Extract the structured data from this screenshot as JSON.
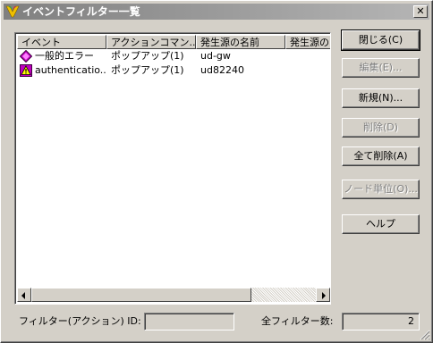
{
  "window": {
    "title": "イベントフィルター一覧",
    "close_glyph": "✕"
  },
  "list": {
    "columns": [
      "イベント",
      "アクションコマン...",
      "発生源の名前",
      "発生源の"
    ],
    "rows": [
      {
        "icon": "error-diamond-icon",
        "event": "一般的エラー",
        "action": "ポップアップ(1)",
        "source": "ud-gw"
      },
      {
        "icon": "warning-triangle-icon",
        "event": "authenticatio...",
        "action": "ポップアップ(1)",
        "source": "ud82240"
      }
    ]
  },
  "buttons": {
    "close": "閉じる(C)",
    "edit": "編集(E)...",
    "new": "新規(N)...",
    "delete": "削除(D)",
    "delete_all": "全て削除(A)",
    "node_unit": "ノード単位(O)...",
    "help": "ヘルプ"
  },
  "footer": {
    "filter_id_label": "フィルター(アクション) ID:",
    "filter_id_value": "",
    "total_label": "全フィルター数:",
    "total_value": "2"
  },
  "colors": {
    "title_start": "#808080",
    "title_end": "#b5b5b5",
    "face": "#d4d0c8",
    "error_icon": "#c000c0",
    "warning_icon": "#ffff00"
  }
}
